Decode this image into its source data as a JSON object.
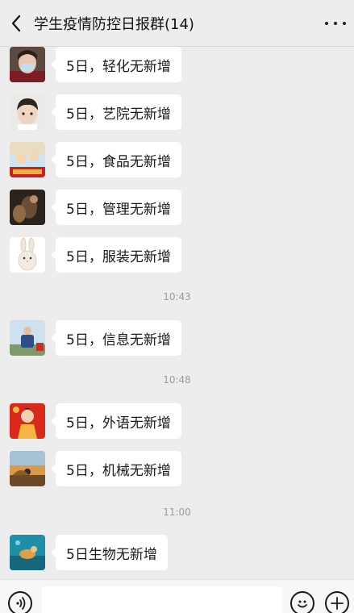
{
  "header": {
    "title": "学生疫情防控日报群(14)"
  },
  "messages": [
    {
      "text": "5日，轻化无新增",
      "avatar": "user-avatar-masked-woman"
    },
    {
      "text": "5日，艺院无新增",
      "avatar": "user-avatar-boy"
    },
    {
      "text": "5日，食品无新增",
      "avatar": "user-avatar-cartoon-china"
    },
    {
      "text": "5日，管理无新增",
      "avatar": "user-avatar-dark-photo"
    },
    {
      "text": "5日，服装无新增",
      "avatar": "user-avatar-rabbit"
    },
    {
      "text": "5日，信息无新增",
      "avatar": "user-avatar-man-flag"
    },
    {
      "text": "5日，外语无新增",
      "avatar": "user-avatar-red-illustration"
    },
    {
      "text": "5日，机械无新增",
      "avatar": "user-avatar-orange-landscape"
    },
    {
      "text": "5日生物无新增",
      "avatar": "user-avatar-underwater"
    }
  ],
  "timestamps": [
    "10:43",
    "10:48",
    "11:00"
  ],
  "input": {
    "placeholder": ""
  },
  "icons": {
    "back": "chevron-left-icon",
    "more": "more-dots-icon",
    "voice": "voice-icon",
    "emoji": "emoji-icon",
    "plus": "plus-icon"
  },
  "colors": {
    "background": "#ededed",
    "bubble": "#ffffff",
    "timestamp": "#9b9b9b"
  }
}
